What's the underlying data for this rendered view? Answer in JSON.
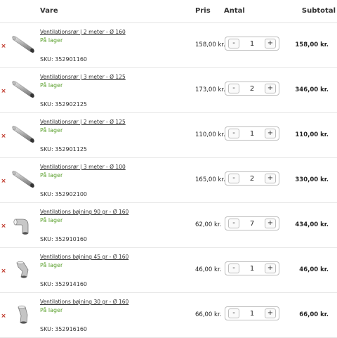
{
  "header": {
    "vare": "Vare",
    "pris": "Pris",
    "antal": "Antal",
    "subtotal": "Subtotal"
  },
  "qty_controls": {
    "minus": "-",
    "plus": "+"
  },
  "remove_symbol": "×",
  "rows": [
    {
      "name": "Ventilationsrør | 2 meter - Ø 160",
      "stock": "På lager",
      "sku": "SKU: 352901160",
      "price": "158,00 kr.",
      "qty": "1",
      "subtotal": "158,00 kr.",
      "icon": "pipe-icon"
    },
    {
      "name": "Ventilationsrør | 3 meter - Ø 125",
      "stock": "På lager",
      "sku": "SKU: 352902125",
      "price": "173,00 kr.",
      "qty": "2",
      "subtotal": "346,00 kr.",
      "icon": "pipe-icon"
    },
    {
      "name": "Ventilationsrør | 2 meter - Ø 125",
      "stock": "På lager",
      "sku": "SKU: 352901125",
      "price": "110,00 kr.",
      "qty": "1",
      "subtotal": "110,00 kr.",
      "icon": "pipe-icon"
    },
    {
      "name": "Ventilationsrør | 3 meter - Ø 100",
      "stock": "På lager",
      "sku": "SKU: 352902100",
      "price": "165,00 kr.",
      "qty": "2",
      "subtotal": "330,00 kr.",
      "icon": "pipe-icon"
    },
    {
      "name": "Ventilations bøjning 90 gr - Ø 160",
      "stock": "På lager",
      "sku": "SKU: 352910160",
      "price": "62,00 kr.",
      "qty": "7",
      "subtotal": "434,00 kr.",
      "icon": "elbow-90-icon"
    },
    {
      "name": "Ventilations bøjning 45 gr - Ø 160",
      "stock": "På lager",
      "sku": "SKU: 352914160",
      "price": "46,00 kr.",
      "qty": "1",
      "subtotal": "46,00 kr.",
      "icon": "elbow-45-icon"
    },
    {
      "name": "Ventilations bøjning 30 gr - Ø 160",
      "stock": "På lager",
      "sku": "SKU: 352916160",
      "price": "66,00 kr.",
      "qty": "1",
      "subtotal": "66,00 kr.",
      "icon": "elbow-30-icon"
    }
  ]
}
